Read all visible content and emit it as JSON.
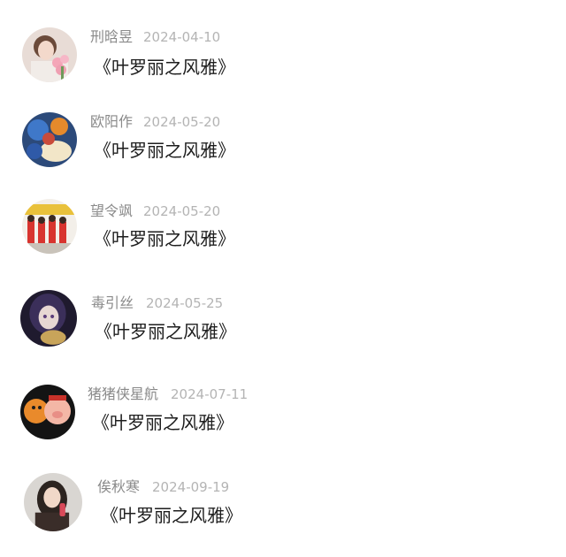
{
  "comments": [
    {
      "name": "刑晗昱",
      "date": "2024-04-10",
      "text": "《叶罗丽之风雅》",
      "avatar": "pink-flower-avatar"
    },
    {
      "name": "欧阳作",
      "date": "2024-05-20",
      "text": "《叶罗丽之风雅》",
      "avatar": "colorful-objects-avatar"
    },
    {
      "name": "望令飒",
      "date": "2024-05-20",
      "text": "《叶罗丽之风雅》",
      "avatar": "group-photo-avatar"
    },
    {
      "name": "毒引丝",
      "date": "2024-05-25",
      "text": "《叶罗丽之风雅》",
      "avatar": "anime-girl-avatar"
    },
    {
      "name": "猪猪侠星航",
      "date": "2024-07-11",
      "text": "《叶罗丽之风雅》",
      "avatar": "cartoon-pig-avatar"
    },
    {
      "name": "俟秋寒",
      "date": "2024-09-19",
      "text": "《叶罗丽之风雅》",
      "avatar": "girl-portrait-avatar"
    }
  ]
}
